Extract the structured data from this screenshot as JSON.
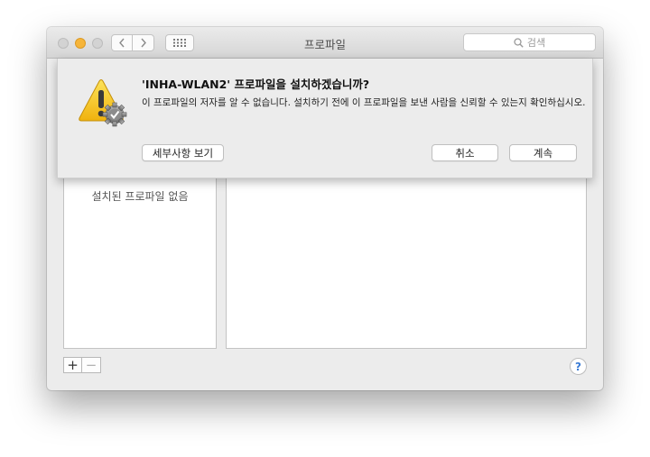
{
  "window": {
    "title": "프로파일",
    "search_placeholder": "검색"
  },
  "sidebar": {
    "empty_label": "설치된 프로파일 없음"
  },
  "toolbar": {
    "add_label": "+",
    "remove_label": "−",
    "help_label": "?"
  },
  "dialog": {
    "title": "'INHA-WLAN2' 프로파일을 설치하겠습니까?",
    "message": "이 프로파일의 저자를 알 수 없습니다. 설치하기 전에 이 프로파일을 보낸 사람을 신뢰할 수 있는지 확인하십시오.",
    "details_button": "세부사항 보기",
    "cancel_button": "취소",
    "continue_button": "계속",
    "icon": "warning-gear-icon"
  },
  "colors": {
    "minimize_light": "#f6b53a",
    "warning_yellow": "#f5c21b",
    "help_blue": "#3a7bd5"
  }
}
